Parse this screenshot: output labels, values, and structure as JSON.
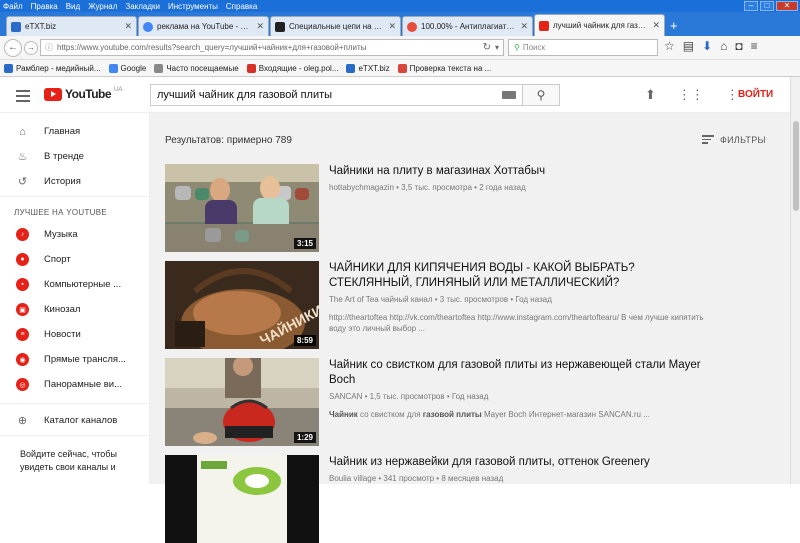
{
  "menubar": [
    "Файл",
    "Правка",
    "Вид",
    "Журнал",
    "Закладки",
    "Инструменты",
    "Справка"
  ],
  "tabs": [
    {
      "title": "eTXT.biz",
      "color": "#2a6ac9",
      "active": false
    },
    {
      "title": "реклама на YouTube - Поиск...",
      "color": "#4285f4",
      "active": false
    },
    {
      "title": "Специальные цепи на базе ...",
      "color": "#222222",
      "active": false
    },
    {
      "title": "100.00% - Антиплагиат онл...",
      "color": "#e74c3c",
      "active": false
    },
    {
      "title": "лучший чайник для газовой...",
      "color": "#e62117",
      "active": true
    }
  ],
  "browser": {
    "url": "https://www.youtube.com/results?search_query=лучший+чайник+для+газовой+плиты",
    "search_placeholder": "Поиск"
  },
  "bookmarks": [
    {
      "label": "Рамблер - медийный...",
      "color": "#2a6ac9"
    },
    {
      "label": "Google",
      "color": "#4285f4"
    },
    {
      "label": "Часто посещаемые",
      "color": "#888888"
    },
    {
      "label": "Входящие - oleg.pol...",
      "color": "#d93025"
    },
    {
      "label": "eTXT.biz",
      "color": "#2a6ac9"
    },
    {
      "label": "Проверка текста на ...",
      "color": "#d9453a"
    }
  ],
  "youtube": {
    "logo": "YouTube",
    "region": "UA",
    "query": "лучший чайник для газовой плиты",
    "login": "ВОЙТИ"
  },
  "sidebar": {
    "main": [
      {
        "label": "Главная",
        "icon": "home-icon"
      },
      {
        "label": "В тренде",
        "icon": "flame-icon"
      },
      {
        "label": "История",
        "icon": "history-icon"
      }
    ],
    "best_header": "ЛУЧШЕЕ НА YOUTUBE",
    "best": [
      {
        "label": "Музыка",
        "icon": "music-icon"
      },
      {
        "label": "Спорт",
        "icon": "sport-icon"
      },
      {
        "label": "Компьютерные ...",
        "icon": "gaming-icon"
      },
      {
        "label": "Кинозал",
        "icon": "film-icon"
      },
      {
        "label": "Новости",
        "icon": "news-icon"
      },
      {
        "label": "Прямые трансля...",
        "icon": "live-icon"
      },
      {
        "label": "Панорамные ви...",
        "icon": "360-icon"
      }
    ],
    "catalog": "Каталог каналов",
    "signin": "Войдите сейчас, чтобы увидеть свои каналы и"
  },
  "results": {
    "count_text": "Результатов: примерно 789",
    "filters": "ФИЛЬТРЫ"
  },
  "videos": [
    {
      "title": "Чайники на плиту в магазинах Хоттабыч",
      "channel": "hottabychmagazin",
      "meta": " • 3,5 тыс. просмотра • 2 года назад",
      "duration": "3:15",
      "desc_html": ""
    },
    {
      "title": "ЧАЙНИКИ ДЛЯ КИПЯЧЕНИЯ ВОДЫ - КАКОЙ ВЫБРАТЬ? СТЕКЛЯННЫЙ, ГЛИНЯНЫЙ ИЛИ МЕТАЛЛИЧЕСКИЙ?",
      "channel": "The Art of Tea чайный канал",
      "meta": " • 3 тыс. просмотров • Год назад",
      "duration": "8:59",
      "desc_html": "http://theartoftea http://vk.com/theartoftea http://www.instagram.com/theartoftearu/ В чем лучше кипятить воду это личный выбор ..."
    },
    {
      "title": "Чайник со свистком для газовой плиты из нержавеющей стали Mayer Boch",
      "channel": "SANCAN",
      "meta": " • 1,5 тыс. просмотров • Год назад",
      "duration": "1:29",
      "desc_bold1": "Чайник",
      "desc_mid": " со свистком для ",
      "desc_bold2": "газовой плиты",
      "desc_end": " Mayer Boch Интернет-магазин SANCAN.ru ..."
    },
    {
      "title": "Чайник из нержавейки для газовой плиты, оттенок Greenery",
      "channel": "Boulia village",
      "meta": " • 341 просмотр • 8 месяцев назад",
      "duration": "",
      "desc_html": ""
    }
  ]
}
